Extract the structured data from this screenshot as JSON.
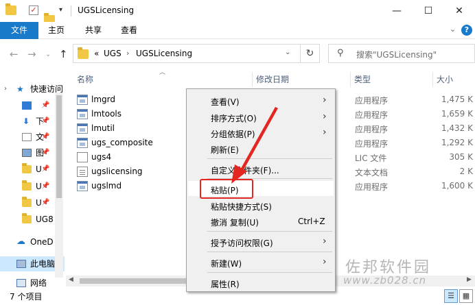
{
  "window": {
    "title": "UGSLicensing"
  },
  "ribbon": {
    "tabs": [
      "文件",
      "主页",
      "共享",
      "查看"
    ]
  },
  "address": {
    "crumbs": [
      "UGS",
      "UGSLicensing"
    ],
    "overflow": "«"
  },
  "search": {
    "placeholder": "搜索\"UGSLicensing\""
  },
  "nav": {
    "items": [
      {
        "label": "快速访问",
        "icon": "star-icon"
      },
      {
        "label": "",
        "icon": "desktop-icon",
        "pinned": true
      },
      {
        "label": "下",
        "icon": "download-icon",
        "pinned": true
      },
      {
        "label": "文",
        "icon": "document-icon",
        "pinned": true
      },
      {
        "label": "图",
        "icon": "picture-icon",
        "pinned": true
      },
      {
        "label": "U",
        "icon": "folder-icon",
        "pinned": true
      },
      {
        "label": "U",
        "icon": "folder-icon",
        "pinned": true
      },
      {
        "label": "U",
        "icon": "folder-icon",
        "pinned": true
      },
      {
        "label": "UG8",
        "icon": "folder-icon"
      },
      {
        "label": "OneD",
        "icon": "cloud-icon"
      },
      {
        "label": "此电脑",
        "icon": "pc-icon"
      },
      {
        "label": "网络",
        "icon": "network-icon"
      }
    ]
  },
  "columns": {
    "name": "名称",
    "modified": "修改日期",
    "type": "类型",
    "size": "大小"
  },
  "files": [
    {
      "name": "lmgrd",
      "type": "应用程序",
      "size": "1,475 K",
      "icon": "exe"
    },
    {
      "name": "lmtools",
      "type": "应用程序",
      "size": "1,659 K",
      "icon": "exe"
    },
    {
      "name": "lmutil",
      "type": "应用程序",
      "size": "1,432 K",
      "icon": "exe"
    },
    {
      "name": "ugs_composite",
      "type": "应用程序",
      "size": "1,292 K",
      "icon": "exe"
    },
    {
      "name": "ugs4",
      "type": "LIC 文件",
      "size": "305 K",
      "icon": "lic"
    },
    {
      "name": "ugslicensing",
      "type": "文本文档",
      "size": "2 K",
      "icon": "txt"
    },
    {
      "name": "ugslmd",
      "type": "应用程序",
      "size": "1,600 K",
      "icon": "exe"
    }
  ],
  "context_menu": {
    "view": "查看(V)",
    "sort": "排序方式(O)",
    "group": "分组依据(P)",
    "refresh": "刷新(E)",
    "customize": "自定义文件夹(F)...",
    "paste": "粘贴(P)",
    "paste_shortcut": "粘贴快捷方式(S)",
    "undo": "撤消 复制(U)",
    "undo_shortcut": "Ctrl+Z",
    "grant": "授予访问权限(G)",
    "new": "新建(W)",
    "properties": "属性(R)"
  },
  "status": {
    "count": "7 个项目"
  },
  "watermark": {
    "line1": "佐邦软件园",
    "line2": "www.zb028.cn"
  },
  "colors": {
    "accent": "#1979ca",
    "highlight": "#e32620",
    "selection": "#cce8ff"
  }
}
